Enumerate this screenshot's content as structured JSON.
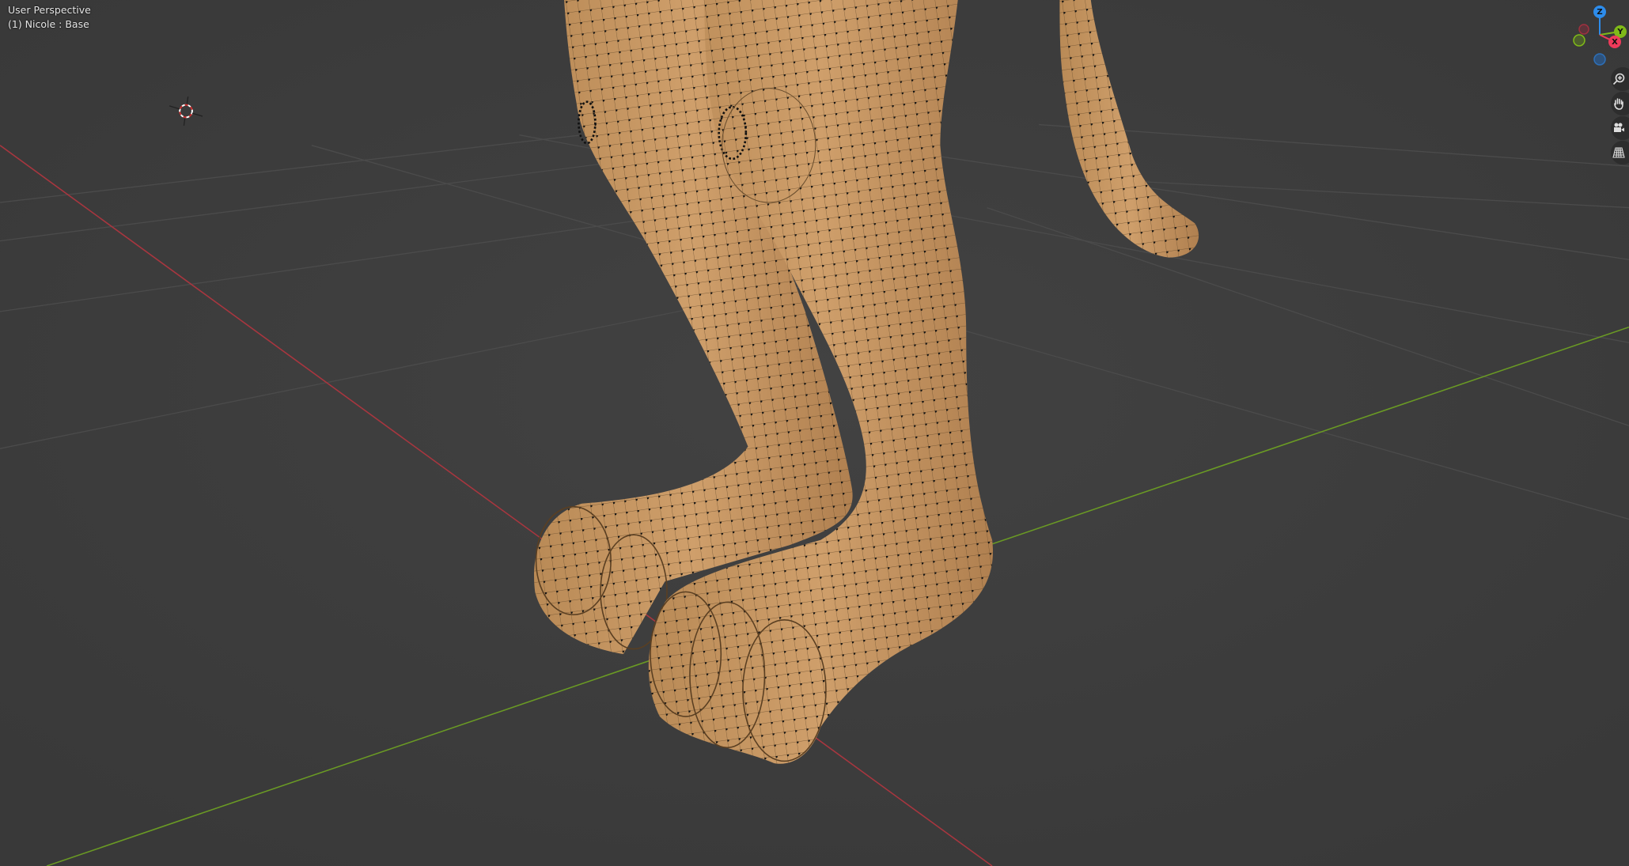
{
  "viewport": {
    "perspective_label": "User Perspective",
    "object_label": "(1) Nicole : Base"
  },
  "gizmo": {
    "x_label": "X",
    "y_label": "Y",
    "z_label": "Z",
    "colors": {
      "x": "#ee3a5a",
      "y": "#7fba18",
      "z": "#2d8ceb"
    }
  },
  "nav_buttons": [
    {
      "name": "zoom",
      "icon": "zoom-in-icon"
    },
    {
      "name": "pan",
      "icon": "hand-icon"
    },
    {
      "name": "camera",
      "icon": "camera-icon"
    },
    {
      "name": "ortho-toggle",
      "icon": "grid-icon"
    }
  ],
  "colors": {
    "background": "#3d3d3d",
    "mesh": "#c89a66",
    "x_axis": "#b0343f",
    "y_axis": "#6d9a22"
  }
}
